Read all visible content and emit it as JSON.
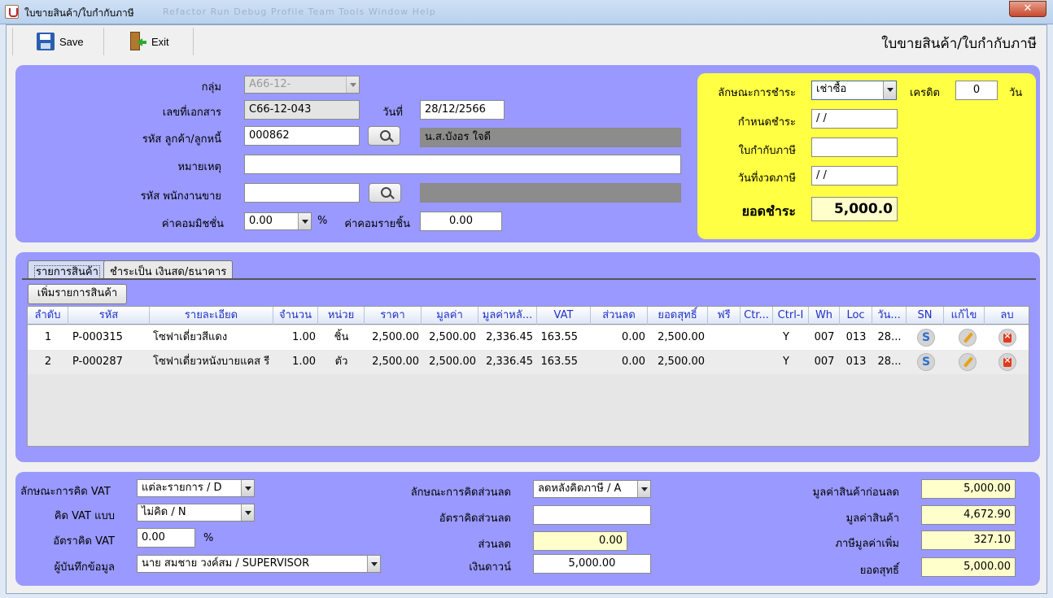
{
  "window": {
    "title": "ใบขายสินค้า/ใบกำกับภาษี",
    "ghost_menu": "Refactor  Run  Debug  Profile  Team  Tools  Window  Help"
  },
  "toolbar": {
    "save_label": "Save",
    "exit_label": "Exit",
    "form_title": "ใบขายสินค้า/ใบกำกับภาษี"
  },
  "header": {
    "group_label": "กลุ่ม",
    "group_value": "A66-12-",
    "docno_label": "เลขที่เอกสาร",
    "docno_value": "C66-12-043",
    "date_label": "วันที่",
    "date_value": "28/12/2566",
    "customer_label": "รหัส ลูกค้า/ลูกหนี้",
    "customer_code": "000862",
    "customer_name": "น.ส.บังอร ใจดี",
    "note_label": "หมายเหตุ",
    "note_value": "",
    "salesman_label": "รหัส พนักงานขาย",
    "salesman_code": "",
    "salesman_name": "",
    "commission_label": "ค่าคอมมิชชั่น",
    "commission_value": "0.00",
    "commission_unit": "%",
    "commission_per_item_label": "ค่าคอมรายชิ้น",
    "commission_per_item_value": "0.00"
  },
  "payment": {
    "type_label": "ลักษณะการชำระ",
    "type_value": "เช่าซื้อ",
    "credit_label": "เครดิต",
    "credit_value": "0",
    "credit_unit": "วัน",
    "due_label": "กำหนดชำระ",
    "due_value": "/ /",
    "taxinv_label": "ใบกำกับภาษี",
    "taxinv_value": "",
    "taxdate_label": "วันที่งวดภาษี",
    "taxdate_value": "/ /",
    "total_label": "ยอดชำระ",
    "total_value": "5,000.0"
  },
  "tabs": [
    {
      "label": "รายการสินค้า"
    },
    {
      "label": "ชำระเป็น เงินสด/ธนาคาร"
    }
  ],
  "add_item_label": "เพิ่มรายการสินค้า",
  "table": {
    "columns": [
      "ลำดับ",
      "รหัส",
      "รายละเอียด",
      "จำนวน",
      "หน่วย",
      "ราคา",
      "มูลค่า",
      "มูลค่าหลั...",
      "VAT",
      "ส่วนลด",
      "ยอดสุทธิ์",
      "ฟรี",
      "Ctr...",
      "Ctrl-I",
      "Wh",
      "Loc",
      "วัน...",
      "SN",
      "แก้ไข",
      "ลบ"
    ],
    "rows": [
      {
        "no": "1",
        "code": "P-000315",
        "desc": "โซฟาเดี่ยวสีแดง",
        "qty": "1.00",
        "unit": "ชิ้น",
        "price": "2,500.00",
        "amount": "2,500.00",
        "after": "2,336.45",
        "vat": "163.55",
        "disc": "0.00",
        "net": "2,500.00",
        "free": "",
        "ctr": "",
        "ctrl": "Y",
        "wh": "007",
        "loc": "013",
        "day": "28..."
      },
      {
        "no": "2",
        "code": "P-000287",
        "desc": "โซฟาเดี่ยวหนังบายแคส รี",
        "qty": "1.00",
        "unit": "ตัว",
        "price": "2,500.00",
        "amount": "2,500.00",
        "after": "2,336.45",
        "vat": "163.55",
        "disc": "0.00",
        "net": "2,500.00",
        "free": "",
        "ctr": "",
        "ctrl": "Y",
        "wh": "007",
        "loc": "013",
        "day": "28..."
      }
    ]
  },
  "footer": {
    "vat_calc_label": "ลักษณะการคิด VAT",
    "vat_calc_value": "แต่ละรายการ / D",
    "vat_mode_label": "คิด VAT แบบ",
    "vat_mode_value": "ไม่คิด / N",
    "vat_rate_label": "อัตราคิด VAT",
    "vat_rate_value": "0.00",
    "vat_rate_unit": "%",
    "recorder_label": "ผู้บันทึกข้อมูล",
    "recorder_value": "นาย สมชาย วงค์สม / SUPERVISOR",
    "disc_calc_label": "ลักษณะการคิดส่วนลด",
    "disc_calc_value": "ลดหลังคิดภาษี / A",
    "disc_rate_label": "อัตราคิดส่วนลด",
    "disc_rate_value": "",
    "disc_label": "ส่วนลด",
    "disc_value": "0.00",
    "down_label": "เงินดาวน์",
    "down_value": "5,000.00",
    "before_disc_label": "มูลค่าสินค้าก่อนลด",
    "before_disc_value": "5,000.00",
    "goods_label": "มูลค่าสินค้า",
    "goods_value": "4,672.90",
    "vat_label": "ภาษีมูลค่าเพิ่ม",
    "vat_value": "327.10",
    "net_label": "ยอดสุทธิ์",
    "net_value": "5,000.00"
  },
  "colors": {
    "panel": "#9999ff",
    "payment_panel": "#ffff44",
    "header_text": "#2030c8"
  }
}
